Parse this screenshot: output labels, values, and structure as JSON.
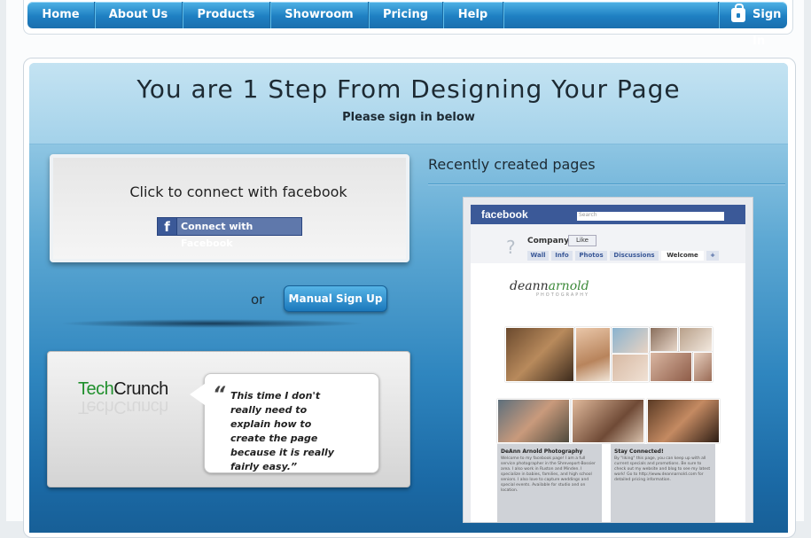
{
  "nav": {
    "items": [
      "Home",
      "About Us",
      "Products",
      "Showroom",
      "Pricing",
      "Help"
    ],
    "signin": "Sign In"
  },
  "header": {
    "title": "You are 1 Step From Designing Your Page",
    "subtitle": "Please sign in below"
  },
  "connect": {
    "title": "Click to connect with facebook",
    "fb_button": "Connect with Facebook",
    "or": "or",
    "manual_button": "Manual Sign Up"
  },
  "testimonial": {
    "brand_tech": "Tech",
    "brand_crunch": "Crunch",
    "quote_mark": "“",
    "quote": "This time I don't really need to explain how to create the page because it is really fairly easy.”"
  },
  "recent": {
    "title": "Recently created pages",
    "preview": {
      "fb_logo": "facebook",
      "search_placeholder": "Search",
      "company": "Company",
      "like": "Like",
      "tabs": [
        "Wall",
        "Info",
        "Photos",
        "Discussions",
        "Welcome",
        "+"
      ],
      "logo_text_a": "deann",
      "logo_text_b": "arnold",
      "logo_sub": "PHOTOGRAPHY",
      "col1_head": "DeAnn Arnold Photography",
      "col1_text": "Welcome to my facebook page! I am a full service photographer in the Shreveport-Bossier area. I also work in Ruston and Minden. I specialize in babies, families, and high school seniors. I also love to capture weddings and special events. Available for studio and on location.",
      "col2_head": "Stay Connected!",
      "col2_text": "By \"liking\" this page, you can keep up with all current specials and promotions. Be sure to check out my website and blog to see my latest work! Go to http://www.deannarnold.com for detailed pricing information."
    }
  }
}
